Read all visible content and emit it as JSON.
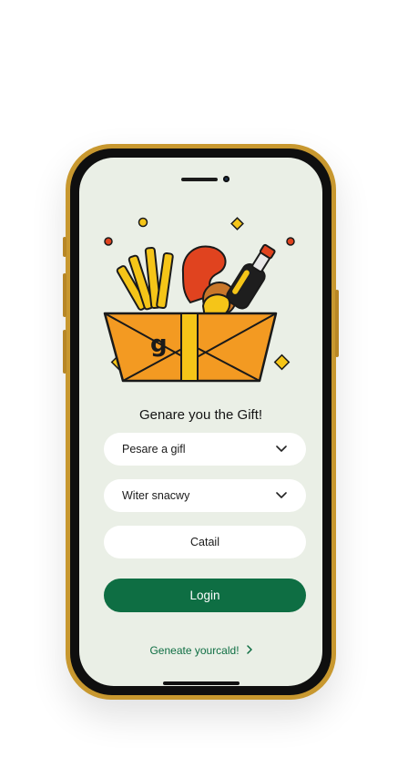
{
  "screen": {
    "title": "Genare you the Gift!",
    "fields": [
      {
        "label": "Pesare a gifl",
        "icon": "chevron-down-icon"
      },
      {
        "label": "Witer snacwy",
        "icon": "chevron-down-icon"
      },
      {
        "label": "Catail"
      }
    ],
    "login_label": "Login",
    "footer_link": "Geneate yourcald!",
    "footer_icon": "chevron-right-icon",
    "basket_letter": "g"
  },
  "colors": {
    "phone_frame": "#c8982f",
    "screen_bg": "#eaefe6",
    "primary_green": "#0e6e43",
    "basket_orange": "#f39a22",
    "accent_red": "#e0431f",
    "accent_yellow": "#f5c518"
  }
}
